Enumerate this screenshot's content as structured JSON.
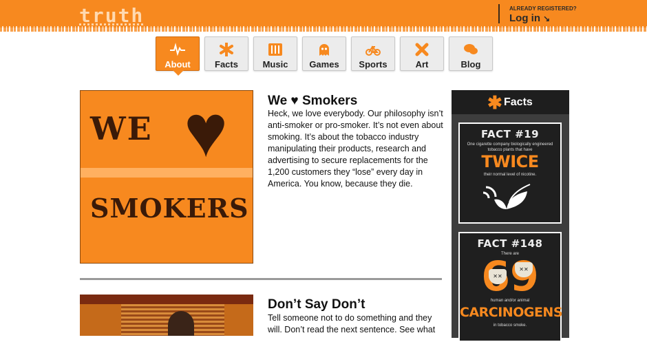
{
  "header": {
    "logo_text": "truth",
    "login_hint": "ALREADY REGISTERED?",
    "login_label": "Log in",
    "accent_color": "#f7891f"
  },
  "nav": {
    "tabs": [
      {
        "label": "About",
        "icon": "pulse-icon",
        "active": true
      },
      {
        "label": "Facts",
        "icon": "asterisk-icon"
      },
      {
        "label": "Music",
        "icon": "equalizer-icon"
      },
      {
        "label": "Games",
        "icon": "ghost-icon"
      },
      {
        "label": "Sports",
        "icon": "bike-icon"
      },
      {
        "label": "Art",
        "icon": "cross-brush-icon"
      },
      {
        "label": "Blog",
        "icon": "speech-bubble-icon"
      }
    ]
  },
  "articles": [
    {
      "title": "We ♥ Smokers",
      "image_text_top": "WE",
      "image_text_bottom": "SMOKERS",
      "body": "Heck, we love everybody. Our philosophy isn’t anti-smoker or pro-smoker. It’s not even about smoking. It’s about the tobacco industry manipulating their products, research and advertising to secure replacements for the 1,200 customers they “lose” every day in America. You know, because they die."
    },
    {
      "title": "Don’t Say Don’t",
      "body": "Tell someone not to do something and they will. Don’t read the next sentence. See what"
    }
  ],
  "sidebar": {
    "title": "Facts",
    "facts": [
      {
        "number": "FACT #19",
        "text": "One cigarette company biologically engineered tobacco plants that have",
        "highlight": "TWICE",
        "subtext": "their normal level of nicotine."
      },
      {
        "number": "FACT #148",
        "text": "There are",
        "highlight_num": "69",
        "subtext": "human and/or animal",
        "highlight": "CARCINOGENS",
        "tail": "in tobacco smoke."
      }
    ]
  }
}
